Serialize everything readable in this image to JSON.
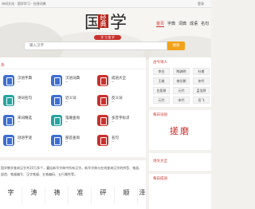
{
  "topbar": {
    "left": "诗词文化 · 国学学习 · 在线词典",
    "right": "登录"
  },
  "logo": {
    "char_left": "国",
    "char_right": "学",
    "seal": "经典",
    "tagline": "学 习 国 学"
  },
  "nav": {
    "items": [
      "首页",
      "字典",
      "词典",
      "成语",
      "名句",
      "诗词",
      "古籍"
    ],
    "active_index": 0
  },
  "search": {
    "placeholder": "输入汉字",
    "button_label": "搜索"
  },
  "main": {
    "section_title": "热",
    "tools": [
      {
        "label": "汉语字典",
        "color": "#3d6fd1"
      },
      {
        "label": "汉语词典",
        "color": "#3d6fd1"
      },
      {
        "label": "成语大全",
        "color": "#c9302c"
      },
      {
        "label": "诗词名句",
        "color": "#27a5a0"
      },
      {
        "label": "近义词",
        "color": "#3d6fd1"
      },
      {
        "label": "反义词",
        "color": "#c9302c"
      },
      {
        "label": "宋词精选",
        "color": "#3d6fd1"
      },
      {
        "label": "笔顺查询",
        "color": "#27a5a0"
      },
      {
        "label": "多音字标识",
        "color": "#c9302c"
      },
      {
        "label": "谜语字谜",
        "color": "#3d6fd1"
      },
      {
        "label": "部首查询",
        "color": "#3d6fd1"
      },
      {
        "label": "名句",
        "color": "#c9302c"
      }
    ]
  },
  "side": {
    "poets_title": "古今诗人",
    "poets": [
      "李白",
      "陶渊明",
      "杜甫",
      "王维",
      "南北朝",
      "宋代",
      "白居易",
      "元代",
      "孟浩然",
      "元代",
      "宋代",
      "岳飞"
    ],
    "daily_title": "每日词语",
    "daily_word": "搓磨",
    "intro_title": "诗文大全",
    "daily2_title": "每日成语"
  },
  "intro": {
    "text": "国学教学查询汉字共20万多个，囊括新华字典中所有汉字。新华字典与在线查询汉字的拼音、笔画、部首、笔顺编号、汉字笔顺、五笔编码、五行属性等。"
  },
  "chars": [
    {
      "pinyin": "",
      "char": "字"
    },
    {
      "pinyin": "",
      "char": "涛"
    },
    {
      "pinyin": "",
      "char": "祷"
    },
    {
      "pinyin": "",
      "char": "准"
    },
    {
      "pinyin": "",
      "char": "砰"
    },
    {
      "pinyin": "",
      "char": "顺"
    },
    {
      "pinyin": "",
      "char": "泽"
    }
  ]
}
